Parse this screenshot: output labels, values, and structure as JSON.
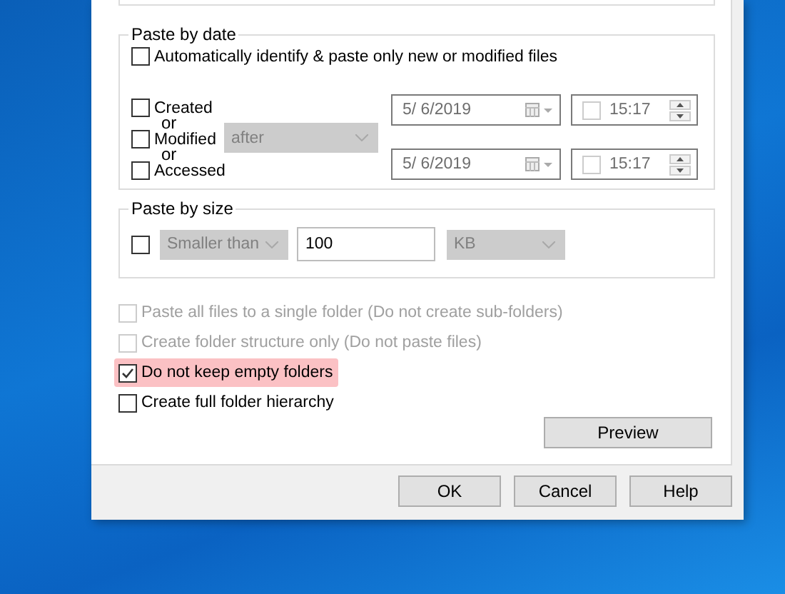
{
  "date_group": {
    "title": "Paste by date",
    "auto_option": {
      "label": "Automatically identify & paste only new or modified files",
      "checked": false
    },
    "attributes": [
      {
        "label": "Created",
        "checked": false
      },
      {
        "label": "Modified",
        "checked": false
      },
      {
        "label": "Accessed",
        "checked": false
      }
    ],
    "connectors": [
      "or",
      "or"
    ],
    "comparison": {
      "value": "after",
      "disabled": true
    },
    "ranges": [
      {
        "date": "5/  6/2019",
        "time": "15:17",
        "time_checked": false,
        "disabled": true
      },
      {
        "date": "5/  6/2019",
        "time": "15:17",
        "time_checked": false,
        "disabled": true
      }
    ]
  },
  "size_group": {
    "title": "Paste by size",
    "checked": false,
    "comparison": "Smaller than",
    "amount": "100",
    "unit": "KB",
    "disabled": true
  },
  "options": [
    {
      "label": "Paste all files to a single folder (Do not create sub-folders)",
      "checked": false,
      "disabled": true,
      "highlighted": false
    },
    {
      "label": "Create folder structure only (Do not paste files)",
      "checked": false,
      "disabled": true,
      "highlighted": false
    },
    {
      "label": "Do not keep empty folders",
      "checked": true,
      "disabled": false,
      "highlighted": true
    },
    {
      "label": "Create full folder hierarchy",
      "checked": false,
      "disabled": false,
      "highlighted": false
    }
  ],
  "preview_button": "Preview",
  "buttons": [
    "OK",
    "Cancel",
    "Help"
  ]
}
